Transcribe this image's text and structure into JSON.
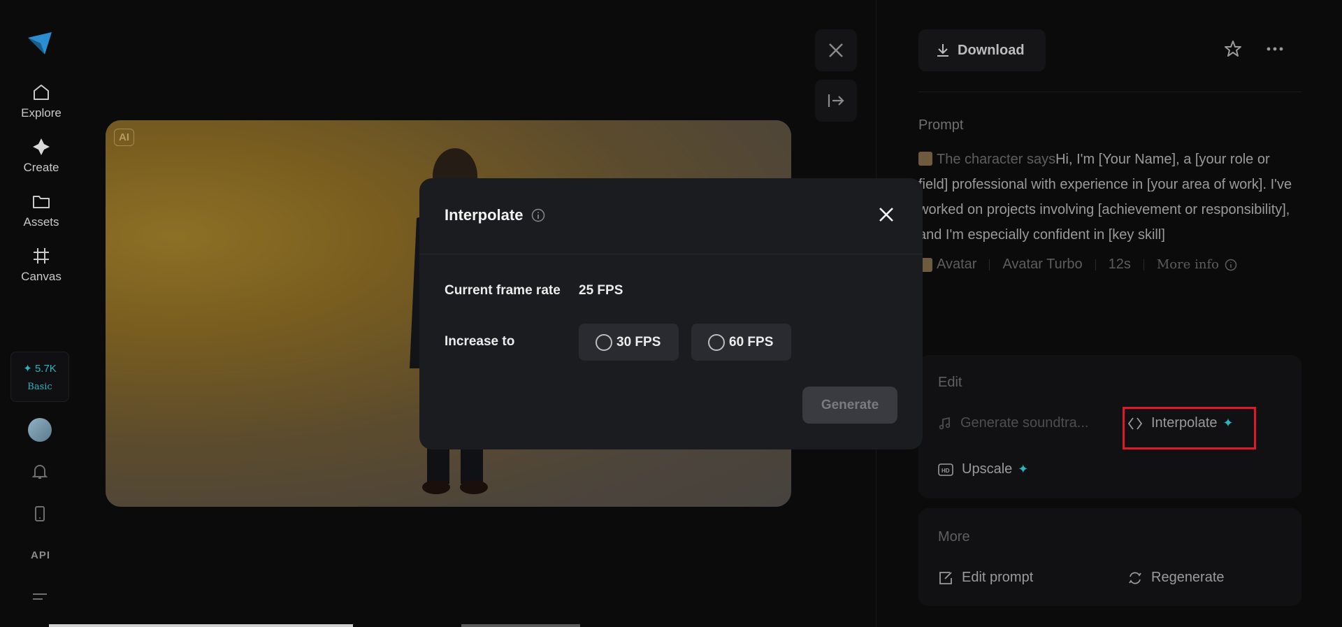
{
  "nav": {
    "items": [
      {
        "label": "Explore",
        "icon": "home-icon"
      },
      {
        "label": "Create",
        "icon": "sparkle-icon"
      },
      {
        "label": "Assets",
        "icon": "folder-icon"
      },
      {
        "label": "Canvas",
        "icon": "grid-icon"
      }
    ],
    "credits": {
      "amount": "✦ 5.7K",
      "plan": "Basic"
    },
    "api_label": "API"
  },
  "media": {
    "ai_badge": "AI"
  },
  "panel": {
    "download_label": "Download",
    "prompt_label": "Prompt",
    "prompt_prefix": "The character says",
    "prompt_body": "Hi, I'm [Your Name], a [your role or field] professional with experience in [your area of work]. I've worked on projects involving [achievement or responsibility], and I'm especially confident in [key skill]",
    "meta": [
      "Avatar",
      "Avatar Turbo",
      "12s",
      "More info"
    ],
    "edit_title": "Edit",
    "edit_items": {
      "soundtrack": "Generate soundtra...",
      "interpolate": "Interpolate",
      "upscale": "Upscale"
    },
    "more_title": "More",
    "more_items": {
      "edit_prompt": "Edit prompt",
      "regenerate": "Regenerate"
    }
  },
  "modal": {
    "title": "Interpolate",
    "current_label": "Current frame rate",
    "current_value": "25 FPS",
    "increase_label": "Increase to",
    "options": [
      "30 FPS",
      "60 FPS"
    ],
    "generate_label": "Generate"
  },
  "colors": {
    "accent": "#2bb3c0",
    "highlight": "#e0182a"
  }
}
